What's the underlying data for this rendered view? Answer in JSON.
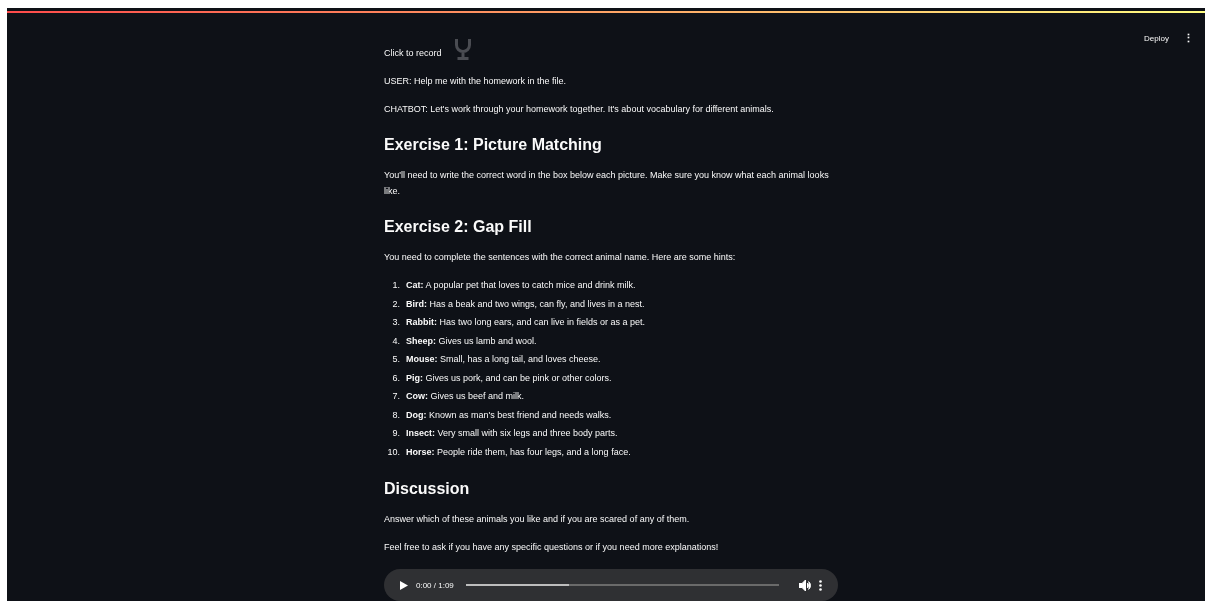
{
  "header": {
    "deploy": "Deploy",
    "menu": "⋮"
  },
  "recorder": {
    "label": "Click to record"
  },
  "messages": [
    {
      "text": "USER: Help me with the homework in the file."
    },
    {
      "text": "CHATBOT: Let's work through your homework together. It's about vocabulary for different animals."
    }
  ],
  "sections": [
    {
      "heading": "Exercise 1: Picture Matching",
      "paragraphs": [
        "You'll need to write the correct word in the box below each picture. Make sure you know what each animal looks like."
      ]
    },
    {
      "heading": "Exercise 2: Gap Fill",
      "paragraphs": [
        "You need to complete the sentences with the correct animal name. Here are some hints:"
      ],
      "list": [
        {
          "number": "1.",
          "text": "**Cat:** A popular pet that loves to catch mice and drink milk."
        },
        {
          "number": "2.",
          "text": "**Bird:** Has a beak and two wings, can fly, and lives in a nest."
        },
        {
          "number": "3.",
          "text": "**Rabbit:** Has two long ears, and can live in fields or as a pet."
        },
        {
          "number": "4.",
          "text": "**Sheep:** Gives us lamb and wool."
        },
        {
          "number": "5.",
          "text": "**Mouse:** Small, has a long tail, and loves cheese."
        },
        {
          "number": "6.",
          "text": "**Pig:** Gives us pork, and can be pink or other colors."
        },
        {
          "number": "7.",
          "text": "**Cow:** Gives us beef and milk."
        },
        {
          "number": "8.",
          "text": "**Dog:** Known as man's best friend and needs walks."
        },
        {
          "number": "9.",
          "text": "**Insect:** Very small with six legs and three body parts."
        },
        {
          "number": "10.",
          "text": "**Horse:** People ride them, has four legs, and a long face."
        }
      ]
    },
    {
      "heading": "Discussion",
      "paragraphs": [
        "Answer which of these animals you like and if you are scared of any of them.",
        "Feel free to ask if you have any specific questions or if you need more explanations!"
      ]
    }
  ],
  "audio": {
    "time": "0:00 / 1:09",
    "level": 0.33
  }
}
